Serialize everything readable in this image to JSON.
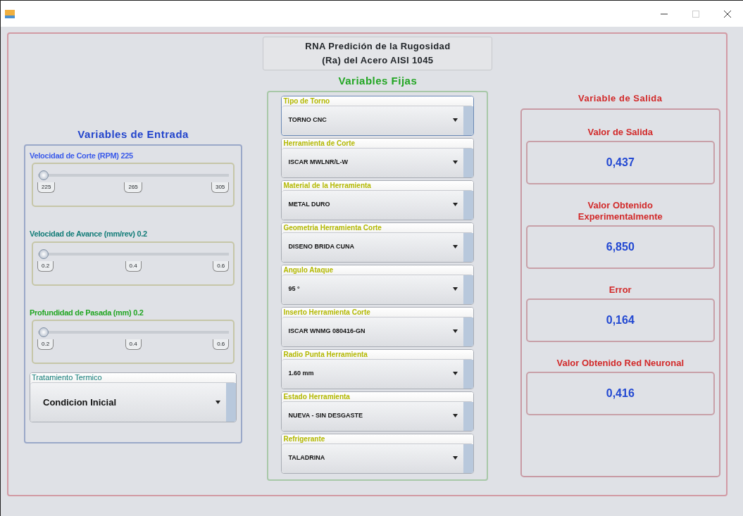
{
  "window": {
    "controls": [
      {
        "kind": "minimize",
        "disabled": false
      },
      {
        "kind": "maximize",
        "disabled": true
      },
      {
        "kind": "close",
        "disabled": false
      }
    ]
  },
  "title": [
    "RNA Predición de la Rugosidad",
    "(Ra) del Acero AISI 1045"
  ],
  "input_panel": {
    "heading": "Variables de Entrada",
    "sliders": [
      {
        "label": "Velocidad de Corte (RPM) 225",
        "color": "#3b5bea",
        "level": 0,
        "ticks": [
          "225",
          "265",
          "305"
        ]
      },
      {
        "label": "Velocidad de Avance (mm/rev) 0.2",
        "color": "#127c78",
        "level": 0,
        "ticks": [
          "0.2",
          "0.4",
          "0.6"
        ]
      },
      {
        "label": "Profundidad de Pasada (mm) 0.2",
        "color": "#23a624",
        "level": 0,
        "ticks": [
          "0.2",
          "0.4",
          "0.6"
        ]
      }
    ],
    "combo": {
      "label": "Tratamiento Termico",
      "value": "Condicion Inicial"
    }
  },
  "fixed_panel": {
    "heading": "Variables Fijas",
    "combos": [
      {
        "label": "Tipo de Torno",
        "value": "TORNO CNC",
        "focused": true
      },
      {
        "label": "Herramienta de Corte",
        "value": "ISCAR MWLNR/L-W",
        "focused": false
      },
      {
        "label": "Material de la Herramienta",
        "value": "METAL DURO",
        "focused": false
      },
      {
        "label": "Geometria Herramienta Corte",
        "value": "DISENO BRIDA CUNA",
        "focused": false
      },
      {
        "label": "Angulo Ataque",
        "value": "95 °",
        "focused": false
      },
      {
        "label": "Inserto Herramienta Corte",
        "value": "ISCAR WNMG 080416-GN",
        "focused": false
      },
      {
        "label": "Radio Punta Herramienta",
        "value": "1.60 mm",
        "focused": false
      },
      {
        "label": "Estado Herramienta",
        "value": "NUEVA - SIN DESGASTE",
        "focused": false
      },
      {
        "label": "Refrigerante",
        "value": "TALADRINA",
        "focused": false
      }
    ]
  },
  "output_panel": {
    "heading": "Variable de Salida",
    "outputs": [
      {
        "label": "Valor de Salida",
        "value": "0,437"
      },
      {
        "label": "Valor Obtenido Experimentalmente",
        "value": "6,850"
      },
      {
        "label": "Error",
        "value": "0,164"
      },
      {
        "label": "Valor Obtenido Red Neuronal",
        "value": "0,416"
      }
    ]
  }
}
